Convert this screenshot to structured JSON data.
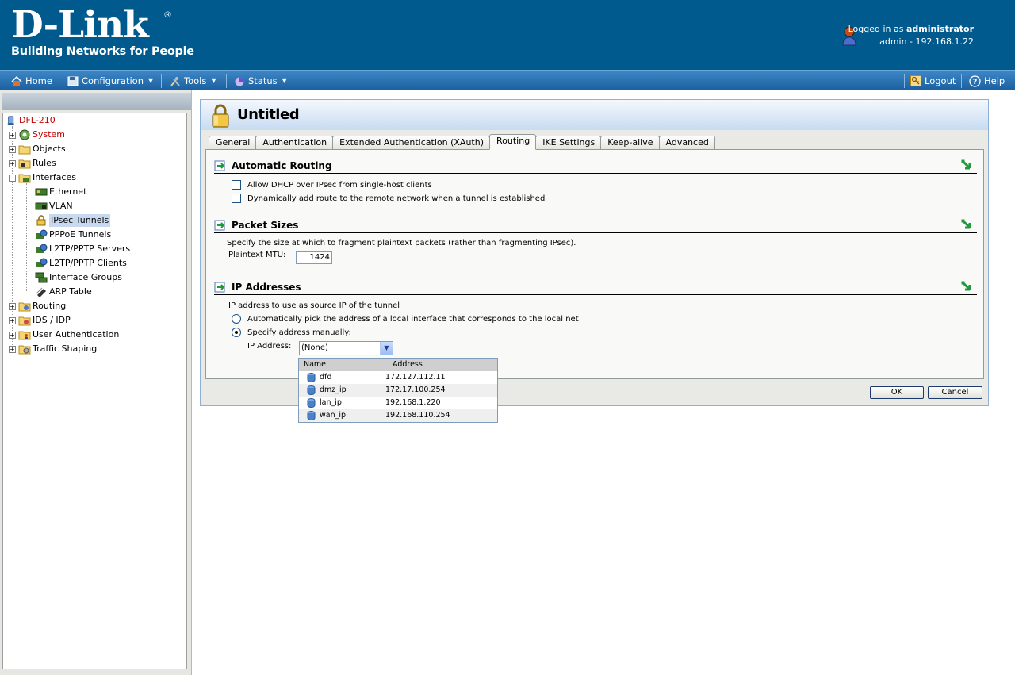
{
  "header": {
    "brand": "D-Link",
    "registered": "®",
    "tagline": "Building Networks for People",
    "logged_in_prefix": "Logged in as",
    "logged_in_user": "administrator",
    "session": "admin - 192.168.1.22"
  },
  "menubar": {
    "home": "Home",
    "configuration": "Configuration",
    "tools": "Tools",
    "status": "Status",
    "logout": "Logout",
    "help": "Help"
  },
  "tree": {
    "root": "DFL-210",
    "system": "System",
    "objects": "Objects",
    "rules": "Rules",
    "interfaces": "Interfaces",
    "ethernet": "Ethernet",
    "vlan": "VLAN",
    "ipsec_tunnels": "IPsec Tunnels",
    "pppoe_tunnels": "PPPoE Tunnels",
    "l2tp_servers": "L2TP/PPTP Servers",
    "l2tp_clients": "L2TP/PPTP Clients",
    "interface_groups": "Interface Groups",
    "arp_table": "ARP Table",
    "routing": "Routing",
    "ids_idp": "IDS / IDP",
    "user_authentication": "User Authentication",
    "traffic_shaping": "Traffic Shaping"
  },
  "panel": {
    "title": "Untitled",
    "tabs": [
      "General",
      "Authentication",
      "Extended Authentication (XAuth)",
      "Routing",
      "IKE Settings",
      "Keep-alive",
      "Advanced"
    ],
    "active_tab": "Routing"
  },
  "automatic_routing": {
    "title": "Automatic Routing",
    "allow_dhcp": "Allow DHCP over IPsec from single-host clients",
    "dynamic_route": "Dynamically add route to the remote network when a tunnel is established"
  },
  "packet_sizes": {
    "title": "Packet Sizes",
    "description": "Specify the size at which to fragment plaintext packets (rather than fragmenting IPsec).",
    "mtu_label": "Plaintext MTU:",
    "mtu_value": "1424"
  },
  "ip_addresses": {
    "title": "IP Addresses",
    "description": "IP address to use as source IP of the tunnel",
    "auto_option": "Automatically pick the address of a local interface that corresponds to the local net",
    "manual_option": "Specify address manually:",
    "ip_label": "IP Address:",
    "selected": "(None)"
  },
  "dropdown": {
    "headers": [
      "Name",
      "Address"
    ],
    "rows": [
      {
        "name": "dfd",
        "address": "172.127.112.11"
      },
      {
        "name": "dmz_ip",
        "address": "172.17.100.254"
      },
      {
        "name": "lan_ip",
        "address": "192.168.1.220"
      },
      {
        "name": "wan_ip",
        "address": "192.168.110.254"
      }
    ]
  },
  "buttons": {
    "ok": "OK",
    "cancel": "Cancel"
  },
  "colors": {
    "header_bg": "#005a8e",
    "menubar": "#2a6db0",
    "tree_system": "#c00000"
  }
}
